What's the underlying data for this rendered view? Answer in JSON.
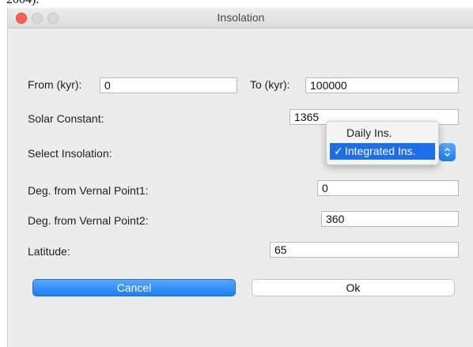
{
  "caption_fragment": "2004).",
  "window": {
    "title": "Insolation"
  },
  "form": {
    "from_label": "From (kyr):",
    "from_value": "0",
    "to_label": "To (kyr):",
    "to_value": "100000",
    "solar_constant_label": "Solar Constant:",
    "solar_constant_value": "1365",
    "select_insolation_label": "Select Insolation:",
    "vernal1_label": "Deg. from Vernal Point1:",
    "vernal1_value": "0",
    "vernal2_label": "Deg. from Vernal Point2:",
    "vernal2_value": "360",
    "latitude_label": "Latitude:",
    "latitude_value": "65"
  },
  "insolation_menu": {
    "options": [
      "Daily Ins.",
      "Integrated Ins."
    ],
    "selected": "Integrated Ins.",
    "checkmark": "✓",
    "stepper_icon": "up-down-chevron-icon"
  },
  "buttons": {
    "cancel_label": "Cancel",
    "ok_label": "Ok"
  },
  "colors": {
    "accent": "#1a7ff5",
    "close_light": "#fc5f57",
    "selection": "#1c6fe8"
  }
}
